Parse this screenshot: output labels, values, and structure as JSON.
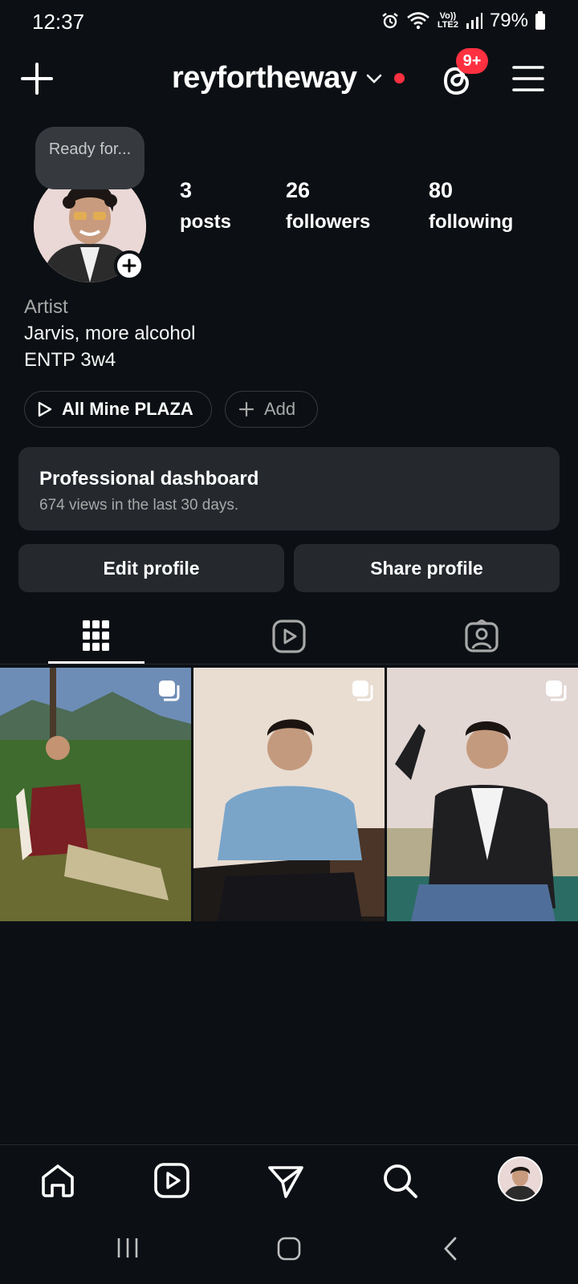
{
  "status_bar": {
    "time": "12:37",
    "battery": "79%",
    "network": "Vo)) LTE2",
    "icons": [
      "alarm-icon",
      "wifi-icon",
      "signal-icon",
      "battery-icon"
    ]
  },
  "header": {
    "username": "reyfortheway",
    "notification_badge": "9+"
  },
  "profile": {
    "note": "Ready for...",
    "stats": [
      {
        "count": "3",
        "label": "posts"
      },
      {
        "count": "26",
        "label": "followers"
      },
      {
        "count": "80",
        "label": "following"
      }
    ],
    "bio": {
      "category": "Artist",
      "line1": "Jarvis, more alcohol",
      "line2": "ENTP 3w4"
    }
  },
  "chips": {
    "music": "All Mine PLAZA",
    "add": "Add"
  },
  "dashboard": {
    "title": "Professional dashboard",
    "subtitle": "674 views in the last 30 days."
  },
  "buttons": {
    "edit": "Edit profile",
    "share": "Share profile"
  },
  "tabs": [
    "grid",
    "reels",
    "tagged"
  ],
  "colors": {
    "background": "#0c1014",
    "surface": "#25292e",
    "accent_red": "#ff3040",
    "muted_text": "#a8a8a8"
  }
}
